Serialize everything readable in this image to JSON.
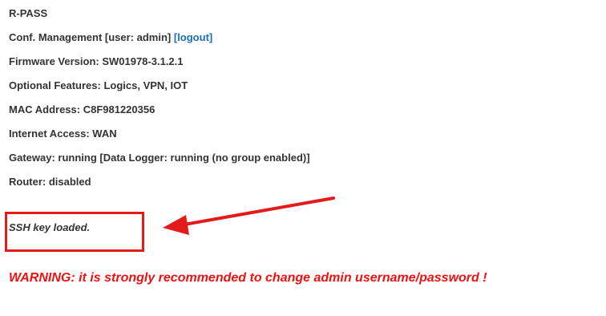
{
  "device": {
    "name": "R-PASS",
    "conf_management_prefix": "Conf. Management [user: admin] ",
    "logout_label": "[logout]",
    "firmware_version": "Firmware Version: SW01978-3.1.2.1",
    "optional_features": "Optional Features: Logics, VPN, IOT",
    "mac_address": "MAC Address: C8F981220356",
    "internet_access": "Internet Access: WAN",
    "gateway": "Gateway: running [Data Logger: running (no group enabled)]",
    "router": "Router: disabled"
  },
  "ssh_status": "SSH key loaded.",
  "warning": "WARNING: it is strongly recommended to change admin username/password !",
  "colors": {
    "text": "#333333",
    "link": "#1a6fb4",
    "annotation_red": "#e31b1b",
    "warning_red": "#ee1111"
  },
  "annotations": {
    "highlight_box": "red-rectangle",
    "pointer": "red-arrow"
  }
}
